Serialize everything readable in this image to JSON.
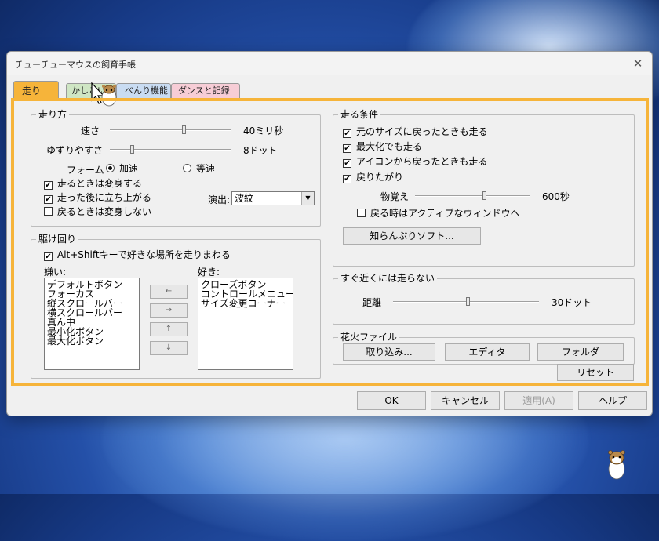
{
  "window": {
    "title": "チューチューマウスの飼育手帳",
    "close_glyph": "✕"
  },
  "tabs": [
    {
      "label": "走り",
      "active": true,
      "color": "#f6b43a"
    },
    {
      "label": "かしこい",
      "color": "#cfe6c4"
    },
    {
      "label": "べんり機能",
      "color": "#c9dcf2"
    },
    {
      "label": "ダンスと記録",
      "color": "#f7cdd6"
    }
  ],
  "hashiri": {
    "legend": "走り方",
    "speed": {
      "label": "速さ",
      "value": "40ミリ秒",
      "level": 0.62
    },
    "yield": {
      "label": "ゆずりやすさ",
      "value": "8ドット",
      "level": 0.22
    },
    "form_label": "フォーム",
    "radio_accel": "加速",
    "radio_const": "等速",
    "chk_transform": "走るときは変身する",
    "chk_standup": "走った後に立ち上がる",
    "chk_noreturn": "戻るときは変身しない",
    "effect_label": "演出:",
    "effect_value": "波紋",
    "select_arrow": "▼"
  },
  "kakemawari": {
    "legend": "駆け回り",
    "chk_altshift": "Alt+Shiftキーで好きな場所を走りまわる",
    "dislike_label": "嫌い:",
    "like_label": "好き:",
    "dislike_items": [
      "デフォルトボタン",
      "フォーカス",
      "縦スクロールバー",
      "横スクロールバー",
      "真ん中",
      "最小化ボタン",
      "最大化ボタン"
    ],
    "like_items": [
      "クローズボタン",
      "コントロールメニュー",
      "サイズ変更コーナー"
    ],
    "arrows": [
      "←",
      "→",
      "↑",
      "↓"
    ]
  },
  "conditions": {
    "legend": "走る条件",
    "chk_restore": "元のサイズに戻ったときも走る",
    "chk_maximize": "最大化でも走る",
    "chk_icon": "アイコンから戻ったときも走る",
    "chk_back": "戻りたがり",
    "memory": {
      "label": "物覚え",
      "value": "600秒",
      "level": 0.6
    },
    "chk_active": "戻る時はアクティブなウィンドウへ",
    "shiranpuri_button": "知らんぷりソフト..."
  },
  "nearby": {
    "legend": "すぐ近くには走らない",
    "distance": {
      "label": "距離",
      "value": "30ドット",
      "level": 0.52
    }
  },
  "fireworks": {
    "legend": "花火ファイル",
    "import_button": "取り込み...",
    "editor_button": "エディタ",
    "folder_button": "フォルダ"
  },
  "reset_button": "リセット",
  "dialog_buttons": {
    "ok": "OK",
    "cancel": "キャンセル",
    "apply": "適用(A)",
    "help": "ヘルプ"
  },
  "check_glyph": "✔",
  "accent_color": "#f6b43a"
}
